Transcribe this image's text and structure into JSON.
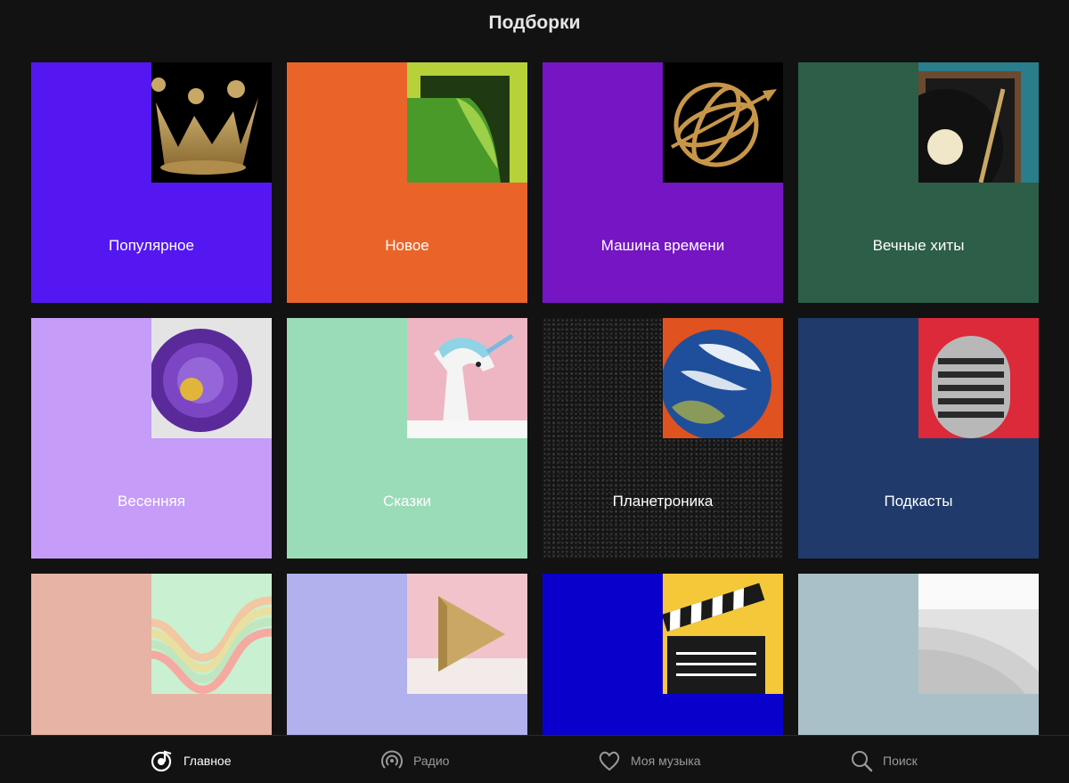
{
  "header": {
    "title": "Подборки"
  },
  "tiles": [
    {
      "label": "Популярное",
      "bg": "#5417f2",
      "icon": "crown-icon"
    },
    {
      "label": "Новое",
      "bg": "#ea642a",
      "icon": "page-curl-icon"
    },
    {
      "label": "Машина времени",
      "bg": "#7515c3",
      "icon": "armillary-sphere-icon"
    },
    {
      "label": "Вечные хиты",
      "bg": "#2c5e48",
      "icon": "vinyl-record-icon"
    },
    {
      "label": "Весенняя",
      "bg": "#c59cf7",
      "icon": "flower-icon"
    },
    {
      "label": "Сказки",
      "bg": "#9adcb7",
      "icon": "unicorn-icon"
    },
    {
      "label": "Планетроника",
      "bg": "#151515",
      "icon": "earth-icon"
    },
    {
      "label": "Подкасты",
      "bg": "#1f3a6b",
      "icon": "microphone-icon"
    },
    {
      "label": "",
      "bg": "#e6b3a4",
      "icon": "waves-icon"
    },
    {
      "label": "",
      "bg": "#b1b1ed",
      "icon": "play-triangle-icon"
    },
    {
      "label": "",
      "bg": "#0a00cc",
      "icon": "clapperboard-icon"
    },
    {
      "label": "",
      "bg": "#aac0c8",
      "icon": "stairs-icon"
    }
  ],
  "tabbar": {
    "items": [
      {
        "label": "Главное",
        "icon": "home-note-icon",
        "active": true
      },
      {
        "label": "Радио",
        "icon": "radio-icon",
        "active": false
      },
      {
        "label": "Моя музыка",
        "icon": "heart-icon",
        "active": false
      },
      {
        "label": "Поиск",
        "icon": "search-icon",
        "active": false
      }
    ]
  }
}
